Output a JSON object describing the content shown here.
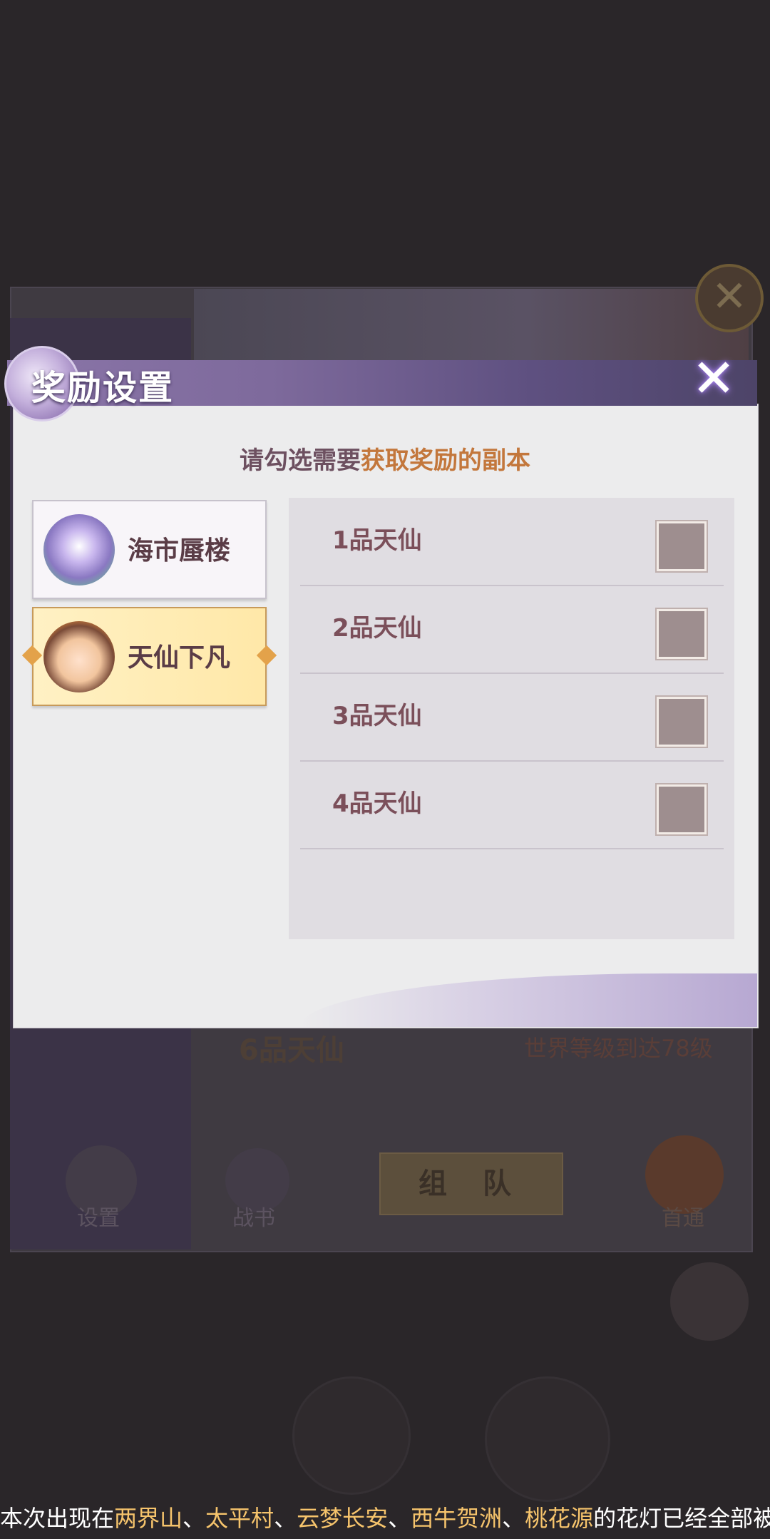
{
  "background": {
    "tier_6_label": "6品天仙",
    "world_level_text": "世界等级到达78级",
    "settings_label": "设置",
    "book_label": "战书",
    "team_button": "组 队",
    "first_clear_label": "首通"
  },
  "dialog": {
    "title": "奖励设置",
    "instruction_prefix": "请勾选需要",
    "instruction_highlight": "获取奖励的副本",
    "dungeons": [
      {
        "label": "海市蜃楼",
        "icon": "pearl-shell-icon",
        "selected": false
      },
      {
        "label": "天仙下凡",
        "icon": "hero-avatar-icon",
        "selected": true
      }
    ],
    "tiers": [
      {
        "label": "1品天仙",
        "checked": false
      },
      {
        "label": "2品天仙",
        "checked": false
      },
      {
        "label": "3品天仙",
        "checked": false
      },
      {
        "label": "4品天仙",
        "checked": false
      }
    ]
  },
  "marquee": {
    "prefix": "本次出现在",
    "loc1": "两界山",
    "sep1": "、",
    "loc2": "太平村",
    "sep2": "、",
    "loc3": "云梦长安",
    "sep3": "、",
    "loc4": "西牛贺洲",
    "sep4": "、",
    "loc5": "桃花源",
    "suffix": "的花灯已经全部被开启了"
  },
  "colors": {
    "highlight": "#c3773c",
    "marquee_highlight": "#f6c46c",
    "selected_bg": "#ffe8a8"
  }
}
